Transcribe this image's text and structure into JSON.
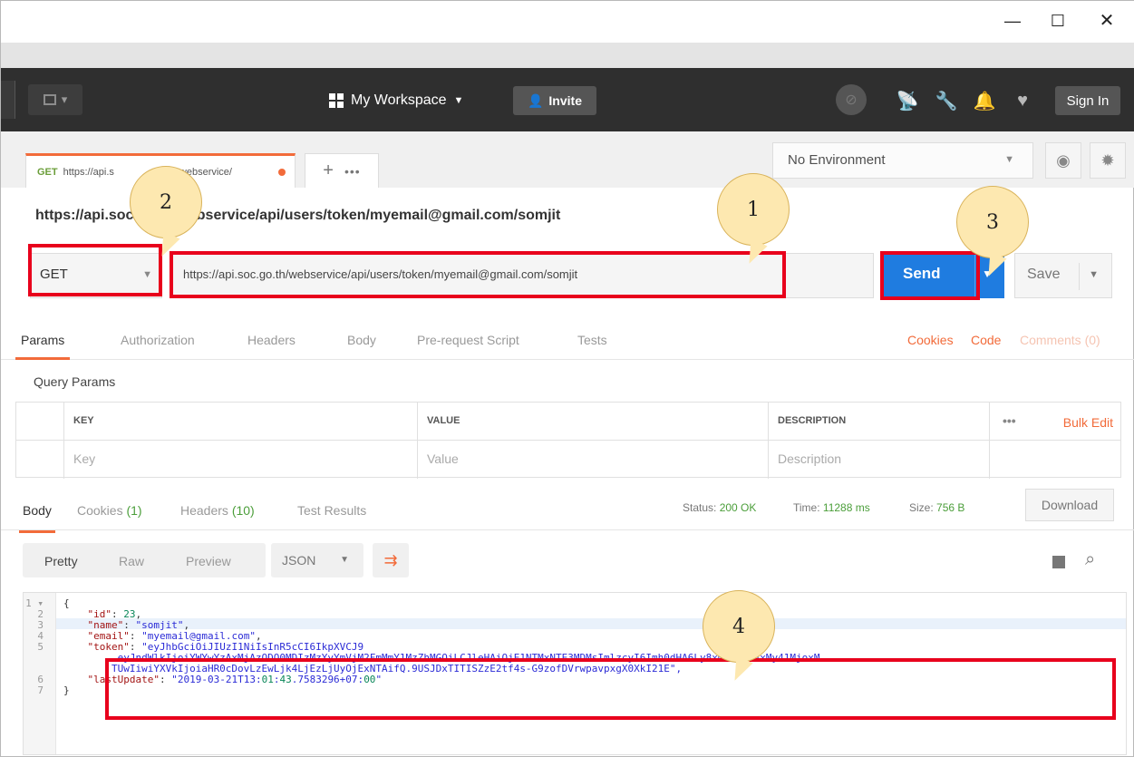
{
  "window": {
    "minimize": "—",
    "maximize": "☐",
    "close": "✕"
  },
  "header": {
    "workspace_label": "My Workspace",
    "workspace_caret": "▼",
    "invite_label": "Invite",
    "signin_label": "Sign In"
  },
  "tab": {
    "method": "GET",
    "url_partial": "https://api.s",
    "url_partial2": "webservice/",
    "add": "+",
    "more": "•••"
  },
  "environment": {
    "label": "No Environment"
  },
  "request": {
    "title": "https://api.soc.go.th/webservice/api/users/token/myemail@gmail.com/somjit",
    "method": "GET",
    "url": "https://api.soc.go.th/webservice/api/users/token/myemail@gmail.com/somjit",
    "send_label": "Send",
    "save_label": "Save"
  },
  "request_tabs": [
    "Params",
    "Authorization",
    "Headers",
    "Body",
    "Pre-request Script",
    "Tests"
  ],
  "request_links": {
    "cookies": "Cookies",
    "code": "Code",
    "comments": "Comments (0)"
  },
  "query_params": {
    "title": "Query Params",
    "headers": [
      "KEY",
      "VALUE",
      "DESCRIPTION"
    ],
    "placeholders": [
      "Key",
      "Value",
      "Description"
    ],
    "more": "•••",
    "bulk_edit": "Bulk Edit"
  },
  "response_tabs": {
    "body": "Body",
    "cookies": "Cookies",
    "cookies_count": "(1)",
    "headers": "Headers",
    "headers_count": "(10)",
    "tests": "Test Results"
  },
  "response_status": {
    "status_label": "Status:",
    "status_value": "200 OK",
    "time_label": "Time:",
    "time_value": "11288 ms",
    "size_label": "Size:",
    "size_value": "756 B",
    "download": "Download"
  },
  "response_view": {
    "modes": [
      "Pretty",
      "Raw",
      "Preview"
    ],
    "format": "JSON"
  },
  "code_lines": [
    {
      "n": "1 ▾",
      "text": "{"
    },
    {
      "n": "2",
      "text": "    \"id\": 23,"
    },
    {
      "n": "3",
      "text": "    \"name\": \"somjit\","
    },
    {
      "n": "4",
      "text": "    \"email\": \"myemail@gmail.com\","
    },
    {
      "n": "5",
      "text": "    \"token\": \"eyJhbGciOiJIUzI1NiIsInR5cCI6IkpXVCJ9"
    },
    {
      "n": "",
      "text": "        .eyJndWlkIjoiYWYwYzAxMjAzODQ0MDIzMzYyYmVjM2FmMmY1MzZhMGQiLCJleHAiOjE1NTMxNTE3MDMsImlzcyI6Imh0dHA6Ly8xMC45OC4xMy41MjoxM"
    },
    {
      "n": "",
      "text": "        TUwIiwiYXVkIjoiaHR0cDovLzEwLjk4LjEzLjUyOjExNTAifQ.9USJDxTITISZzE2tf4s-G9zofDVrwpavpxgX0XkI21E\","
    },
    {
      "n": "6",
      "text": "    \"lastUpdate\": \"2019-03-21T13:01:43.7583296+07:00\""
    },
    {
      "n": "7",
      "text": "}"
    }
  ],
  "annotations": [
    "1",
    "2",
    "3",
    "4"
  ],
  "colors": {
    "accent": "#f26b3a",
    "send": "#1f7ce0",
    "annotation_box": "#e8001c",
    "bubble": "#fde8b0"
  }
}
